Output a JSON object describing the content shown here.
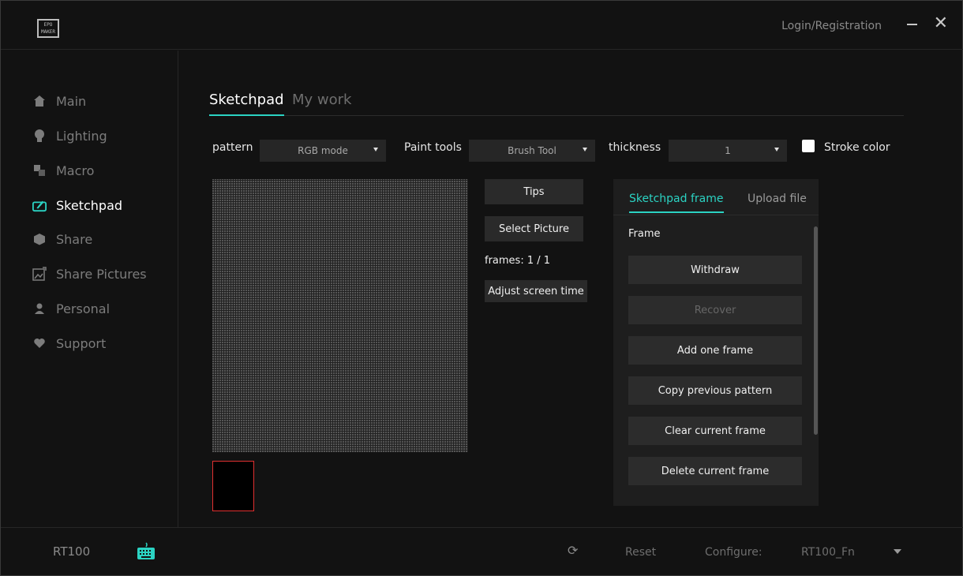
{
  "app": {
    "logo_text": "EPOMAKER",
    "login_label": "Login/Registration",
    "minimize_icon": "minimize-icon",
    "close_icon": "close-icon"
  },
  "sidebar": {
    "items": [
      {
        "label": "Main",
        "icon": "home-icon",
        "active": false
      },
      {
        "label": "Lighting",
        "icon": "bulb-icon",
        "active": false
      },
      {
        "label": "Macro",
        "icon": "macro-icon",
        "active": false
      },
      {
        "label": "Sketchpad",
        "icon": "sketchpad-icon",
        "active": true
      },
      {
        "label": "Share",
        "icon": "cube-icon",
        "active": false
      },
      {
        "label": "Share Pictures",
        "icon": "picture-share-icon",
        "active": false
      },
      {
        "label": "Personal",
        "icon": "person-icon",
        "active": false
      },
      {
        "label": "Support",
        "icon": "heart-icon",
        "active": false
      }
    ]
  },
  "main": {
    "tabs": [
      {
        "label": "Sketchpad",
        "active": true
      },
      {
        "label": "My work",
        "active": false
      }
    ],
    "controls": {
      "pattern_label": "pattern",
      "pattern_value": "RGB mode",
      "paint_tools_label": "Paint tools",
      "paint_tools_value": "Brush Tool",
      "thickness_label": "thickness",
      "thickness_value": "1",
      "stroke_color_label": "Stroke color",
      "stroke_color_checked": false
    },
    "buttons": {
      "tips": "Tips",
      "select_picture": "Select Picture",
      "frames": "frames: 1 / 1",
      "adjust_time": "Adjust screen time"
    }
  },
  "panel": {
    "tabs": [
      {
        "label": "Sketchpad frame",
        "active": true
      },
      {
        "label": "Upload file",
        "active": false
      }
    ],
    "frame_label": "Frame",
    "buttons": [
      {
        "label": "Withdraw",
        "enabled": true
      },
      {
        "label": "Recover",
        "enabled": false
      },
      {
        "label": "Add one frame",
        "enabled": true
      },
      {
        "label": "Copy previous pattern",
        "enabled": true
      },
      {
        "label": "Clear current frame",
        "enabled": true
      },
      {
        "label": "Delete current frame",
        "enabled": true
      }
    ]
  },
  "bottom": {
    "device": "RT100",
    "reset_label": "Reset",
    "configure_label": "Configure:",
    "configure_value": "RT100_Fn"
  },
  "colors": {
    "accent": "#2bd3c3",
    "background": "#121212",
    "thumb_border": "#e03030"
  }
}
